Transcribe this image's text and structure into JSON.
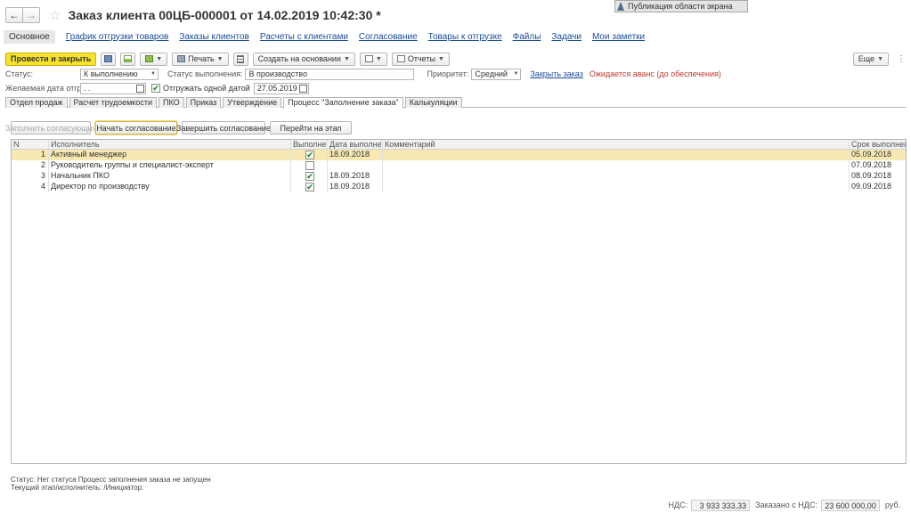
{
  "tooltip": {
    "text": "Публикация области экрана"
  },
  "window": {
    "title": "Заказ клиента 00ЦБ-000001 от 14.02.2019 10:42:30 *"
  },
  "nav_tabs": [
    {
      "label": "Основное"
    },
    {
      "label": "График отгрузки товаров"
    },
    {
      "label": "Заказы клиентов"
    },
    {
      "label": "Расчеты с клиентами"
    },
    {
      "label": "Согласование"
    },
    {
      "label": "Товары к отгрузке"
    },
    {
      "label": "Файлы"
    },
    {
      "label": "Задачи"
    },
    {
      "label": "Мои заметки"
    }
  ],
  "toolbar": {
    "post_close": "Провести и закрыть",
    "print": "Печать",
    "create_based": "Создать на основании",
    "reports": "Отчеты",
    "more": "Еще"
  },
  "form": {
    "status_label": "Статус:",
    "status_value": "К выполнению",
    "exec_status_label": "Статус выполнения:",
    "exec_status_value": "В производство",
    "priority_label": "Приоритет:",
    "priority_value": "Средний",
    "close_order": "Закрыть заказ",
    "advance_note": "Ожидается аванс (до обеспечения)",
    "ship_date_label": "Желаемая дата отгрузки:",
    "ship_date_value": " .  .",
    "ship_one_date_label": "Отгружать одной датой",
    "ship_one_date_value": "27.05.2019"
  },
  "sub_tabs": [
    {
      "label": "Отдел продаж"
    },
    {
      "label": "Расчет трудоемкости"
    },
    {
      "label": "ПКО"
    },
    {
      "label": "Приказ"
    },
    {
      "label": "Утверждение"
    },
    {
      "label": "Процесс \"Заполнение заказа\""
    },
    {
      "label": "Калькуляции"
    }
  ],
  "actions": {
    "fill_approvers": "Заполнить согласующих",
    "start_approval": "Начать согласование",
    "finish_approval": "Завершить согласование",
    "go_to_stage": "Перейти на этап"
  },
  "grid": {
    "columns": {
      "n": "N",
      "executor": "Исполнитель",
      "done": "Выполнено",
      "done_date": "Дата выполнения",
      "comment": "Комментарий",
      "due": "Срок выполнения"
    },
    "rows": [
      {
        "n": "1",
        "executor": "Активный менеджер",
        "done": "✔",
        "done_date": "18.09.2018",
        "comment": "",
        "due": "05.09.2018"
      },
      {
        "n": "2",
        "executor": "Руководитель группы и специалист-эксперт",
        "done": "",
        "done_date": "",
        "comment": "",
        "due": "07.09.2018"
      },
      {
        "n": "3",
        "executor": "Начальник ПКО",
        "done": "✔",
        "done_date": "18.09.2018",
        "comment": "",
        "due": "08.09.2018"
      },
      {
        "n": "4",
        "executor": "Директор по производству",
        "done": "✔",
        "done_date": "18.09.2018",
        "comment": "",
        "due": "09.09.2018"
      }
    ]
  },
  "status_bar": {
    "line1": "Статус: Нет статуса Процесс заполнения заказа не запущен",
    "line2": "Текущий этап/исполнитель: /Инициатор:"
  },
  "totals": {
    "vat_label": "НДС:",
    "vat_value": "3 933 333,33",
    "ordered_label": "Заказано с НДС:",
    "ordered_value": "23 600 000,00",
    "currency": "руб."
  }
}
